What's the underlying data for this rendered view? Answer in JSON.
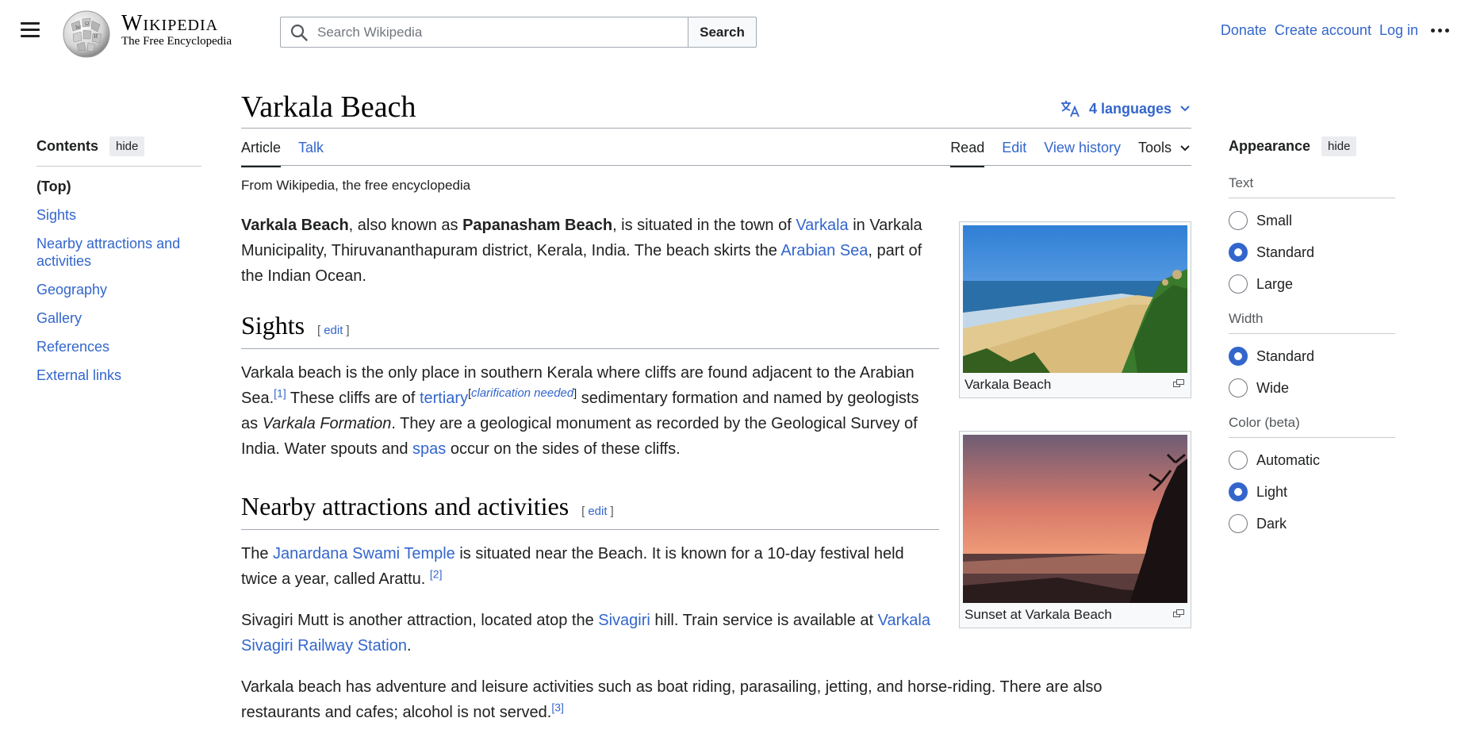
{
  "header": {
    "menu_icon": "hamburger-menu-icon",
    "wordmark_title": "Wikipedia",
    "wordmark_tagline": "The Free Encyclopedia",
    "search_placeholder": "Search Wikipedia",
    "search_button": "Search",
    "links": {
      "donate": "Donate",
      "create_account": "Create account",
      "log_in": "Log in"
    }
  },
  "toc": {
    "title": "Contents",
    "hide": "hide",
    "items": [
      "(Top)",
      "Sights",
      "Nearby attractions and activities",
      "Geography",
      "Gallery",
      "References",
      "External links"
    ]
  },
  "page": {
    "title": "Varkala Beach",
    "languages": "4 languages",
    "tabs_left": [
      "Article",
      "Talk"
    ],
    "tabs_right": [
      "Read",
      "Edit",
      "View history"
    ],
    "tools": "Tools",
    "tagline": "From Wikipedia, the free encyclopedia"
  },
  "content": {
    "intro": {
      "b1": "Varkala Beach",
      "t1": ", also known as ",
      "b2": "Papanasham Beach",
      "t2": ", is situated in the town of ",
      "l1": "Varkala",
      "t3": " in Varkala Municipality, Thiruvananthapuram district, Kerala, India. The beach skirts the ",
      "l2": "Arabian Sea",
      "t4": ", part of the Indian Ocean."
    },
    "edit_label": "edit",
    "sights": {
      "heading": "Sights",
      "t1": "Varkala beach is the only place in southern Kerala where cliffs are found adjacent to the Arabian Sea.",
      "ref1": "[1]",
      "t2": " These cliffs are of ",
      "l1": "tertiary",
      "clar": "clarification needed",
      "t3": " sedimentary formation and named by geologists as ",
      "i1": "Varkala Formation",
      "t4": ". They are a geological monument as recorded by the Geological Survey of India. Water spouts and ",
      "l2": "spas",
      "t5": " occur on the sides of these cliffs."
    },
    "nearby": {
      "heading": "Nearby attractions and activities",
      "p1_t1": "The ",
      "p1_l1": "Janardana Swami Temple",
      "p1_t2": " is situated near the Beach. It is known for a 10-day festival held twice a year, called Arattu. ",
      "p1_ref": "[2]",
      "p2_t1": "Sivagiri Mutt is another attraction, located atop the ",
      "p2_l1": "Sivagiri",
      "p2_t2": " hill. Train service is available at ",
      "p2_l2": "Varkala Sivagiri Railway Station",
      "p2_t3": ".",
      "p3_t1": "Varkala beach has adventure and leisure activities such as boat riding, parasailing, jetting, and horse-riding. There are also restaurants and cafes; alcohol is not served.",
      "p3_ref": "[3]"
    }
  },
  "figures": [
    {
      "caption": "Varkala Beach",
      "icon": "enlarge-icon"
    },
    {
      "caption": "Sunset at Varkala Beach",
      "icon": "enlarge-icon"
    }
  ],
  "appearance": {
    "title": "Appearance",
    "hide": "hide",
    "text_label": "Text",
    "text_options": [
      "Small",
      "Standard",
      "Large"
    ],
    "text_selected": "Standard",
    "width_label": "Width",
    "width_options": [
      "Standard",
      "Wide"
    ],
    "width_selected": "Standard",
    "color_label": "Color (beta)",
    "color_options": [
      "Automatic",
      "Light",
      "Dark"
    ],
    "color_selected": "Light"
  },
  "colors": {
    "link": "#3366cc",
    "accent": "#3366cc",
    "text": "#202122"
  }
}
